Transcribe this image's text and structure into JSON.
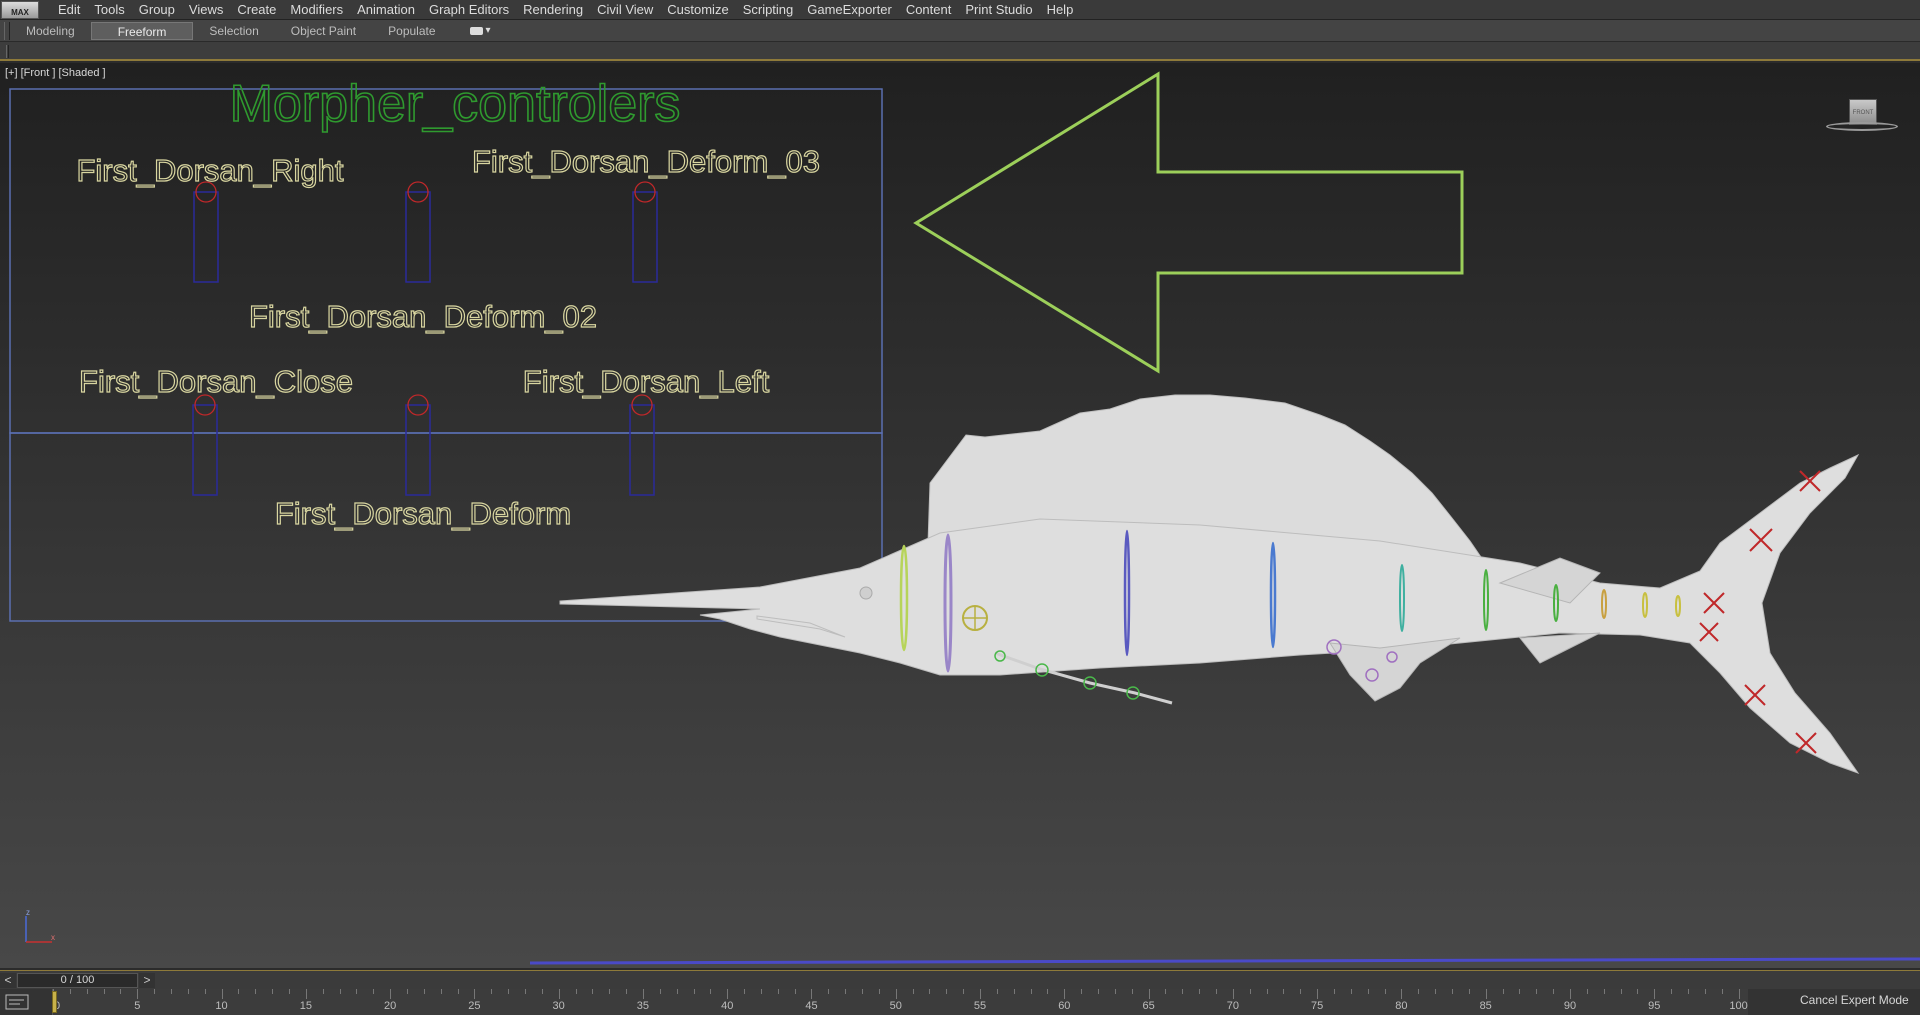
{
  "app": {
    "logo_text": "MAX"
  },
  "menu": [
    "Edit",
    "Tools",
    "Group",
    "Views",
    "Create",
    "Modifiers",
    "Animation",
    "Graph Editors",
    "Rendering",
    "Civil View",
    "Customize",
    "Scripting",
    "GameExporter",
    "Content",
    "Print Studio",
    "Help"
  ],
  "ribbon": {
    "tabs": [
      {
        "label": "Modeling",
        "active": false
      },
      {
        "label": "Freeform",
        "active": true
      },
      {
        "label": "Selection",
        "active": false
      },
      {
        "label": "Object Paint",
        "active": false
      },
      {
        "label": "Populate",
        "active": false
      }
    ]
  },
  "viewport": {
    "label": "[+] [Front ] [Shaded ]",
    "viewcube_label": "FRONT",
    "morpher_title": "Morpher_controlers",
    "controller_labels": {
      "first_dorsan_right": "First_Dorsan_Right",
      "first_dorsan_deform_03": "First_Dorsan_Deform_03",
      "first_dorsan_deform_02": "First_Dorsan_Deform_02",
      "first_dorsan_close": "First_Dorsan_Close",
      "first_dorsan_left": "First_Dorsan_Left",
      "first_dorsan_deform": "First_Dorsan_Deform"
    },
    "axis": {
      "z": "z",
      "x": "x"
    }
  },
  "timeline": {
    "frame_display": "0 / 100",
    "prev": "<",
    "next": ">",
    "ticks": [
      "0",
      "5",
      "10",
      "15",
      "20",
      "25",
      "30",
      "35",
      "40",
      "45",
      "50",
      "55",
      "60",
      "65",
      "70",
      "75",
      "80",
      "85",
      "90",
      "95",
      "100"
    ],
    "current_frame": 0,
    "frame_end": 100
  },
  "status": {
    "cancel_expert_mode": "Cancel Expert Mode"
  },
  "colors": {
    "title_green": "#2f9a2f",
    "label_yellow": "#d9d6a0",
    "arrow_green": "#9ccf5a",
    "frame_blue": "#5a6fb0",
    "slider_blue": "#2a2a9a",
    "handle_red": "#c0282a"
  }
}
